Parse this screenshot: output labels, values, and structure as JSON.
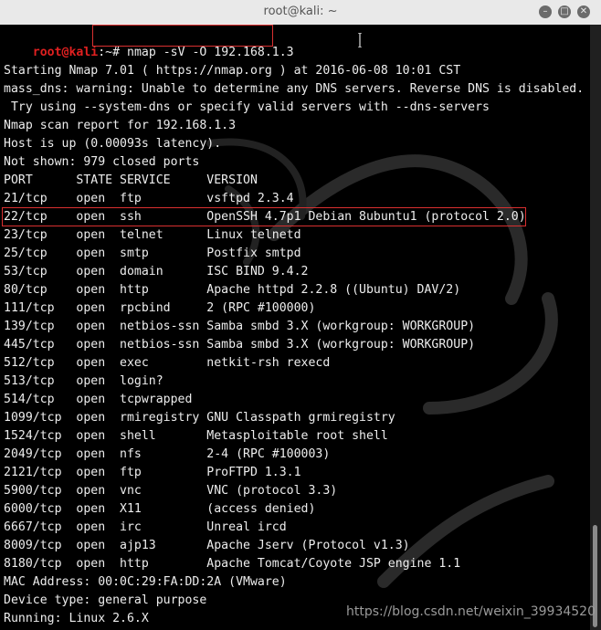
{
  "window": {
    "title": "root@kali: ~"
  },
  "prompt": {
    "user_host": "root@kali",
    "path_sym": ":~# ",
    "command": "nmap -sV -O 192.168.1.3"
  },
  "lines": [
    "Starting Nmap 7.01 ( https://nmap.org ) at 2016-06-08 10:01 CST",
    "mass_dns: warning: Unable to determine any DNS servers. Reverse DNS is disabled.",
    " Try using --system-dns or specify valid servers with --dns-servers",
    "Nmap scan report for 192.168.1.3",
    "Host is up (0.00093s latency).",
    "Not shown: 979 closed ports",
    "PORT      STATE SERVICE     VERSION",
    "21/tcp    open  ftp         vsftpd 2.3.4",
    "22/tcp    open  ssh         OpenSSH 4.7p1 Debian 8ubuntu1 (protocol 2.0)",
    "23/tcp    open  telnet      Linux telnetd",
    "25/tcp    open  smtp        Postfix smtpd",
    "53/tcp    open  domain      ISC BIND 9.4.2",
    "80/tcp    open  http        Apache httpd 2.2.8 ((Ubuntu) DAV/2)",
    "111/tcp   open  rpcbind     2 (RPC #100000)",
    "139/tcp   open  netbios-ssn Samba smbd 3.X (workgroup: WORKGROUP)",
    "445/tcp   open  netbios-ssn Samba smbd 3.X (workgroup: WORKGROUP)",
    "512/tcp   open  exec        netkit-rsh rexecd",
    "513/tcp   open  login?",
    "514/tcp   open  tcpwrapped",
    "1099/tcp  open  rmiregistry GNU Classpath grmiregistry",
    "1524/tcp  open  shell       Metasploitable root shell",
    "2049/tcp  open  nfs         2-4 (RPC #100003)",
    "2121/tcp  open  ftp         ProFTPD 1.3.1",
    "5900/tcp  open  vnc         VNC (protocol 3.3)",
    "6000/tcp  open  X11         (access denied)",
    "6667/tcp  open  irc         Unreal ircd",
    "8009/tcp  open  ajp13       Apache Jserv (Protocol v1.3)",
    "8180/tcp  open  http        Apache Tomcat/Coyote JSP engine 1.1",
    "MAC Address: 00:0C:29:FA:DD:2A (VMware)",
    "Device type: general purpose",
    "Running: Linux 2.6.X"
  ],
  "watermark": "https://blog.csdn.net/weixin_39934520",
  "colors": {
    "prompt": "#e02020",
    "highlight_box": "#d93030",
    "text": "#ededed"
  }
}
